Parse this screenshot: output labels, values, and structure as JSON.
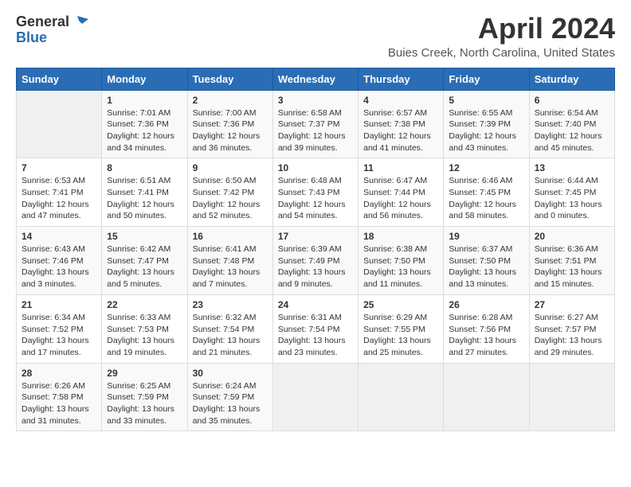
{
  "header": {
    "logo_general": "General",
    "logo_blue": "Blue",
    "title": "April 2024",
    "subtitle": "Buies Creek, North Carolina, United States"
  },
  "days_of_week": [
    "Sunday",
    "Monday",
    "Tuesday",
    "Wednesday",
    "Thursday",
    "Friday",
    "Saturday"
  ],
  "weeks": [
    [
      {
        "day": "",
        "info": ""
      },
      {
        "day": "1",
        "info": "Sunrise: 7:01 AM\nSunset: 7:36 PM\nDaylight: 12 hours\nand 34 minutes."
      },
      {
        "day": "2",
        "info": "Sunrise: 7:00 AM\nSunset: 7:36 PM\nDaylight: 12 hours\nand 36 minutes."
      },
      {
        "day": "3",
        "info": "Sunrise: 6:58 AM\nSunset: 7:37 PM\nDaylight: 12 hours\nand 39 minutes."
      },
      {
        "day": "4",
        "info": "Sunrise: 6:57 AM\nSunset: 7:38 PM\nDaylight: 12 hours\nand 41 minutes."
      },
      {
        "day": "5",
        "info": "Sunrise: 6:55 AM\nSunset: 7:39 PM\nDaylight: 12 hours\nand 43 minutes."
      },
      {
        "day": "6",
        "info": "Sunrise: 6:54 AM\nSunset: 7:40 PM\nDaylight: 12 hours\nand 45 minutes."
      }
    ],
    [
      {
        "day": "7",
        "info": "Sunrise: 6:53 AM\nSunset: 7:41 PM\nDaylight: 12 hours\nand 47 minutes."
      },
      {
        "day": "8",
        "info": "Sunrise: 6:51 AM\nSunset: 7:41 PM\nDaylight: 12 hours\nand 50 minutes."
      },
      {
        "day": "9",
        "info": "Sunrise: 6:50 AM\nSunset: 7:42 PM\nDaylight: 12 hours\nand 52 minutes."
      },
      {
        "day": "10",
        "info": "Sunrise: 6:48 AM\nSunset: 7:43 PM\nDaylight: 12 hours\nand 54 minutes."
      },
      {
        "day": "11",
        "info": "Sunrise: 6:47 AM\nSunset: 7:44 PM\nDaylight: 12 hours\nand 56 minutes."
      },
      {
        "day": "12",
        "info": "Sunrise: 6:46 AM\nSunset: 7:45 PM\nDaylight: 12 hours\nand 58 minutes."
      },
      {
        "day": "13",
        "info": "Sunrise: 6:44 AM\nSunset: 7:45 PM\nDaylight: 13 hours\nand 0 minutes."
      }
    ],
    [
      {
        "day": "14",
        "info": "Sunrise: 6:43 AM\nSunset: 7:46 PM\nDaylight: 13 hours\nand 3 minutes."
      },
      {
        "day": "15",
        "info": "Sunrise: 6:42 AM\nSunset: 7:47 PM\nDaylight: 13 hours\nand 5 minutes."
      },
      {
        "day": "16",
        "info": "Sunrise: 6:41 AM\nSunset: 7:48 PM\nDaylight: 13 hours\nand 7 minutes."
      },
      {
        "day": "17",
        "info": "Sunrise: 6:39 AM\nSunset: 7:49 PM\nDaylight: 13 hours\nand 9 minutes."
      },
      {
        "day": "18",
        "info": "Sunrise: 6:38 AM\nSunset: 7:50 PM\nDaylight: 13 hours\nand 11 minutes."
      },
      {
        "day": "19",
        "info": "Sunrise: 6:37 AM\nSunset: 7:50 PM\nDaylight: 13 hours\nand 13 minutes."
      },
      {
        "day": "20",
        "info": "Sunrise: 6:36 AM\nSunset: 7:51 PM\nDaylight: 13 hours\nand 15 minutes."
      }
    ],
    [
      {
        "day": "21",
        "info": "Sunrise: 6:34 AM\nSunset: 7:52 PM\nDaylight: 13 hours\nand 17 minutes."
      },
      {
        "day": "22",
        "info": "Sunrise: 6:33 AM\nSunset: 7:53 PM\nDaylight: 13 hours\nand 19 minutes."
      },
      {
        "day": "23",
        "info": "Sunrise: 6:32 AM\nSunset: 7:54 PM\nDaylight: 13 hours\nand 21 minutes."
      },
      {
        "day": "24",
        "info": "Sunrise: 6:31 AM\nSunset: 7:54 PM\nDaylight: 13 hours\nand 23 minutes."
      },
      {
        "day": "25",
        "info": "Sunrise: 6:29 AM\nSunset: 7:55 PM\nDaylight: 13 hours\nand 25 minutes."
      },
      {
        "day": "26",
        "info": "Sunrise: 6:28 AM\nSunset: 7:56 PM\nDaylight: 13 hours\nand 27 minutes."
      },
      {
        "day": "27",
        "info": "Sunrise: 6:27 AM\nSunset: 7:57 PM\nDaylight: 13 hours\nand 29 minutes."
      }
    ],
    [
      {
        "day": "28",
        "info": "Sunrise: 6:26 AM\nSunset: 7:58 PM\nDaylight: 13 hours\nand 31 minutes."
      },
      {
        "day": "29",
        "info": "Sunrise: 6:25 AM\nSunset: 7:59 PM\nDaylight: 13 hours\nand 33 minutes."
      },
      {
        "day": "30",
        "info": "Sunrise: 6:24 AM\nSunset: 7:59 PM\nDaylight: 13 hours\nand 35 minutes."
      },
      {
        "day": "",
        "info": ""
      },
      {
        "day": "",
        "info": ""
      },
      {
        "day": "",
        "info": ""
      },
      {
        "day": "",
        "info": ""
      }
    ]
  ]
}
